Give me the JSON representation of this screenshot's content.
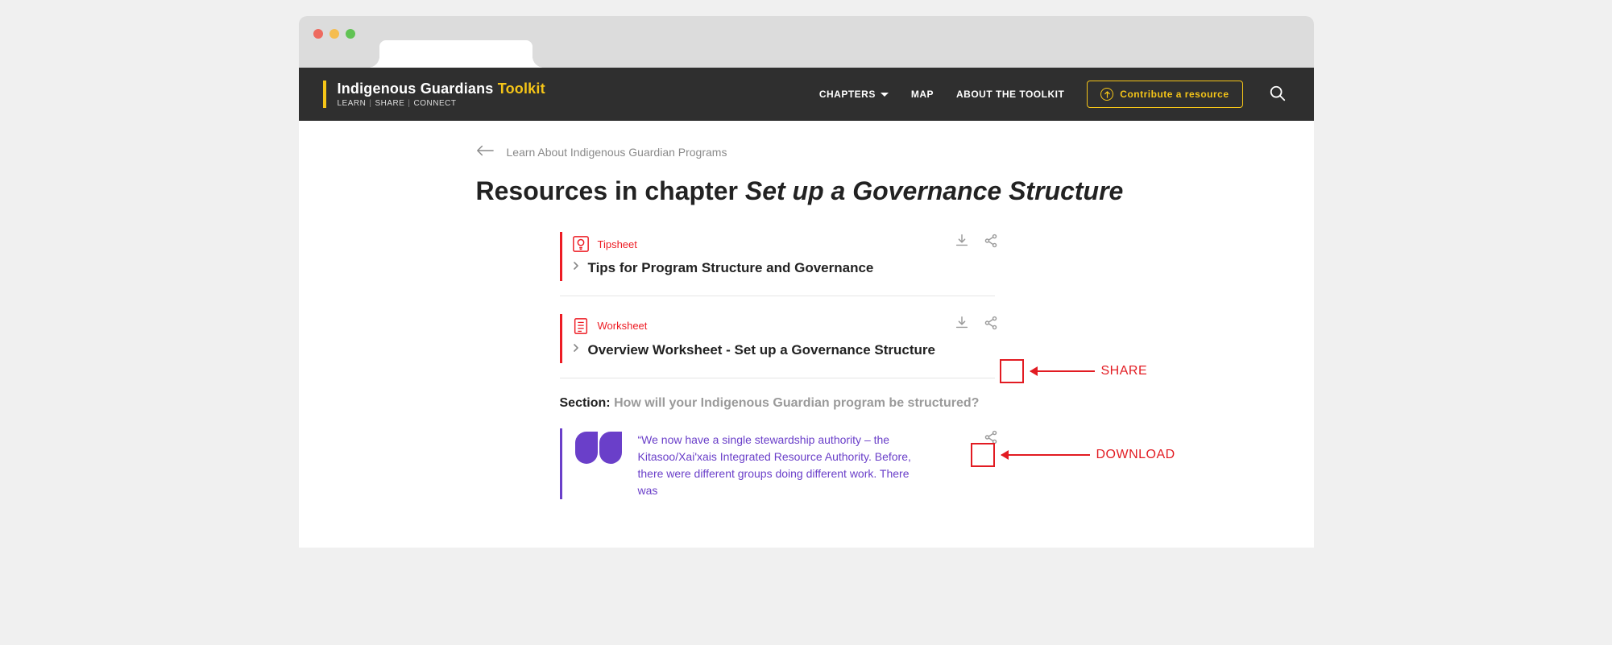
{
  "brand": {
    "name_main": "Indigenous Guardians ",
    "name_accent": "Toolkit"
  },
  "tagline": {
    "a": "LEARN",
    "b": "SHARE",
    "c": "CONNECT"
  },
  "nav": {
    "chapters": "CHAPTERS",
    "map": "MAP",
    "about": "ABOUT THE TOOLKIT",
    "contribute": "Contribute a resource"
  },
  "back": {
    "label": "Learn About Indigenous Guardian Programs"
  },
  "title": {
    "prefix": "Resources in chapter ",
    "chapter": "Set up a Governance Structure"
  },
  "resources": [
    {
      "type": "Tipsheet",
      "title": "Tips for Program Structure and Governance"
    },
    {
      "type": "Worksheet",
      "title": "Overview Worksheet - Set up a Governance Structure"
    }
  ],
  "section": {
    "label": "Section: ",
    "sub": "How will your Indigenous Guardian program be structured?"
  },
  "quote": {
    "text": "“We now have a single stewardship authority – the Kitasoo/Xai'xais Integrated Resource Authority. Before, there were different groups doing different work. There was"
  },
  "annotations": {
    "share": "SHARE",
    "download": "DOWNLOAD"
  }
}
